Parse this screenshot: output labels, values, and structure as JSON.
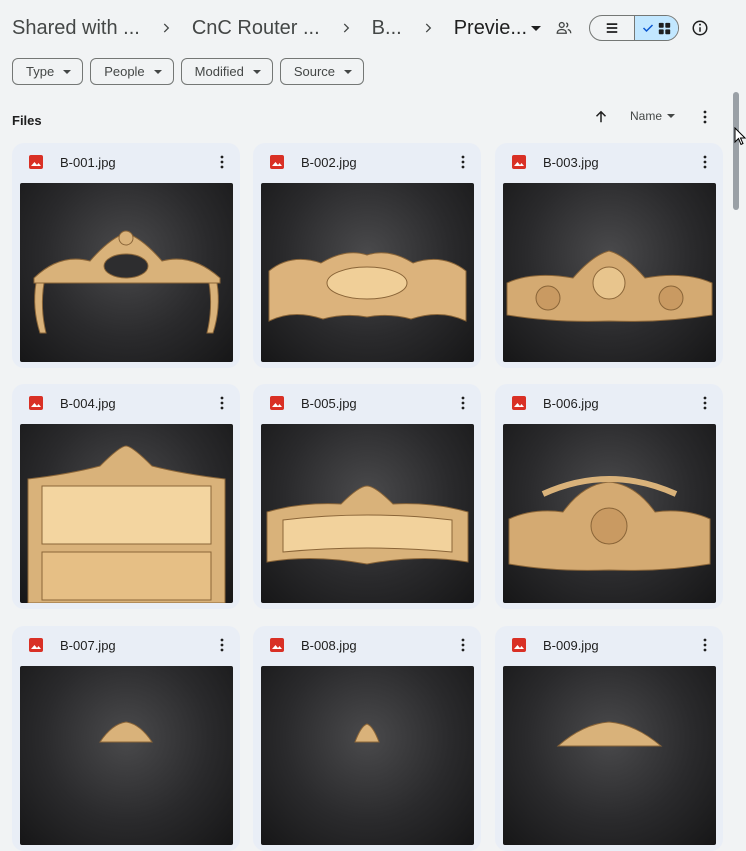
{
  "breadcrumb": [
    {
      "label": "Shared with ..."
    },
    {
      "label": "CnC Router ..."
    },
    {
      "label": "B..."
    },
    {
      "label": "Previe..."
    }
  ],
  "filters": [
    {
      "label": "Type"
    },
    {
      "label": "People"
    },
    {
      "label": "Modified"
    },
    {
      "label": "Source"
    }
  ],
  "section": {
    "title": "Files"
  },
  "sort": {
    "label": "Name",
    "direction": "ascending"
  },
  "files": [
    {
      "name": "B-001.jpg"
    },
    {
      "name": "B-002.jpg"
    },
    {
      "name": "B-003.jpg"
    },
    {
      "name": "B-004.jpg"
    },
    {
      "name": "B-005.jpg"
    },
    {
      "name": "B-006.jpg"
    },
    {
      "name": "B-007.jpg"
    },
    {
      "name": "B-008.jpg"
    },
    {
      "name": "B-009.jpg"
    }
  ],
  "view": {
    "active": "grid"
  },
  "colors": {
    "accent": "#c2e7ff",
    "card": "#e9eef6",
    "image_icon": "#d93025",
    "wood": "#d9b27a"
  }
}
